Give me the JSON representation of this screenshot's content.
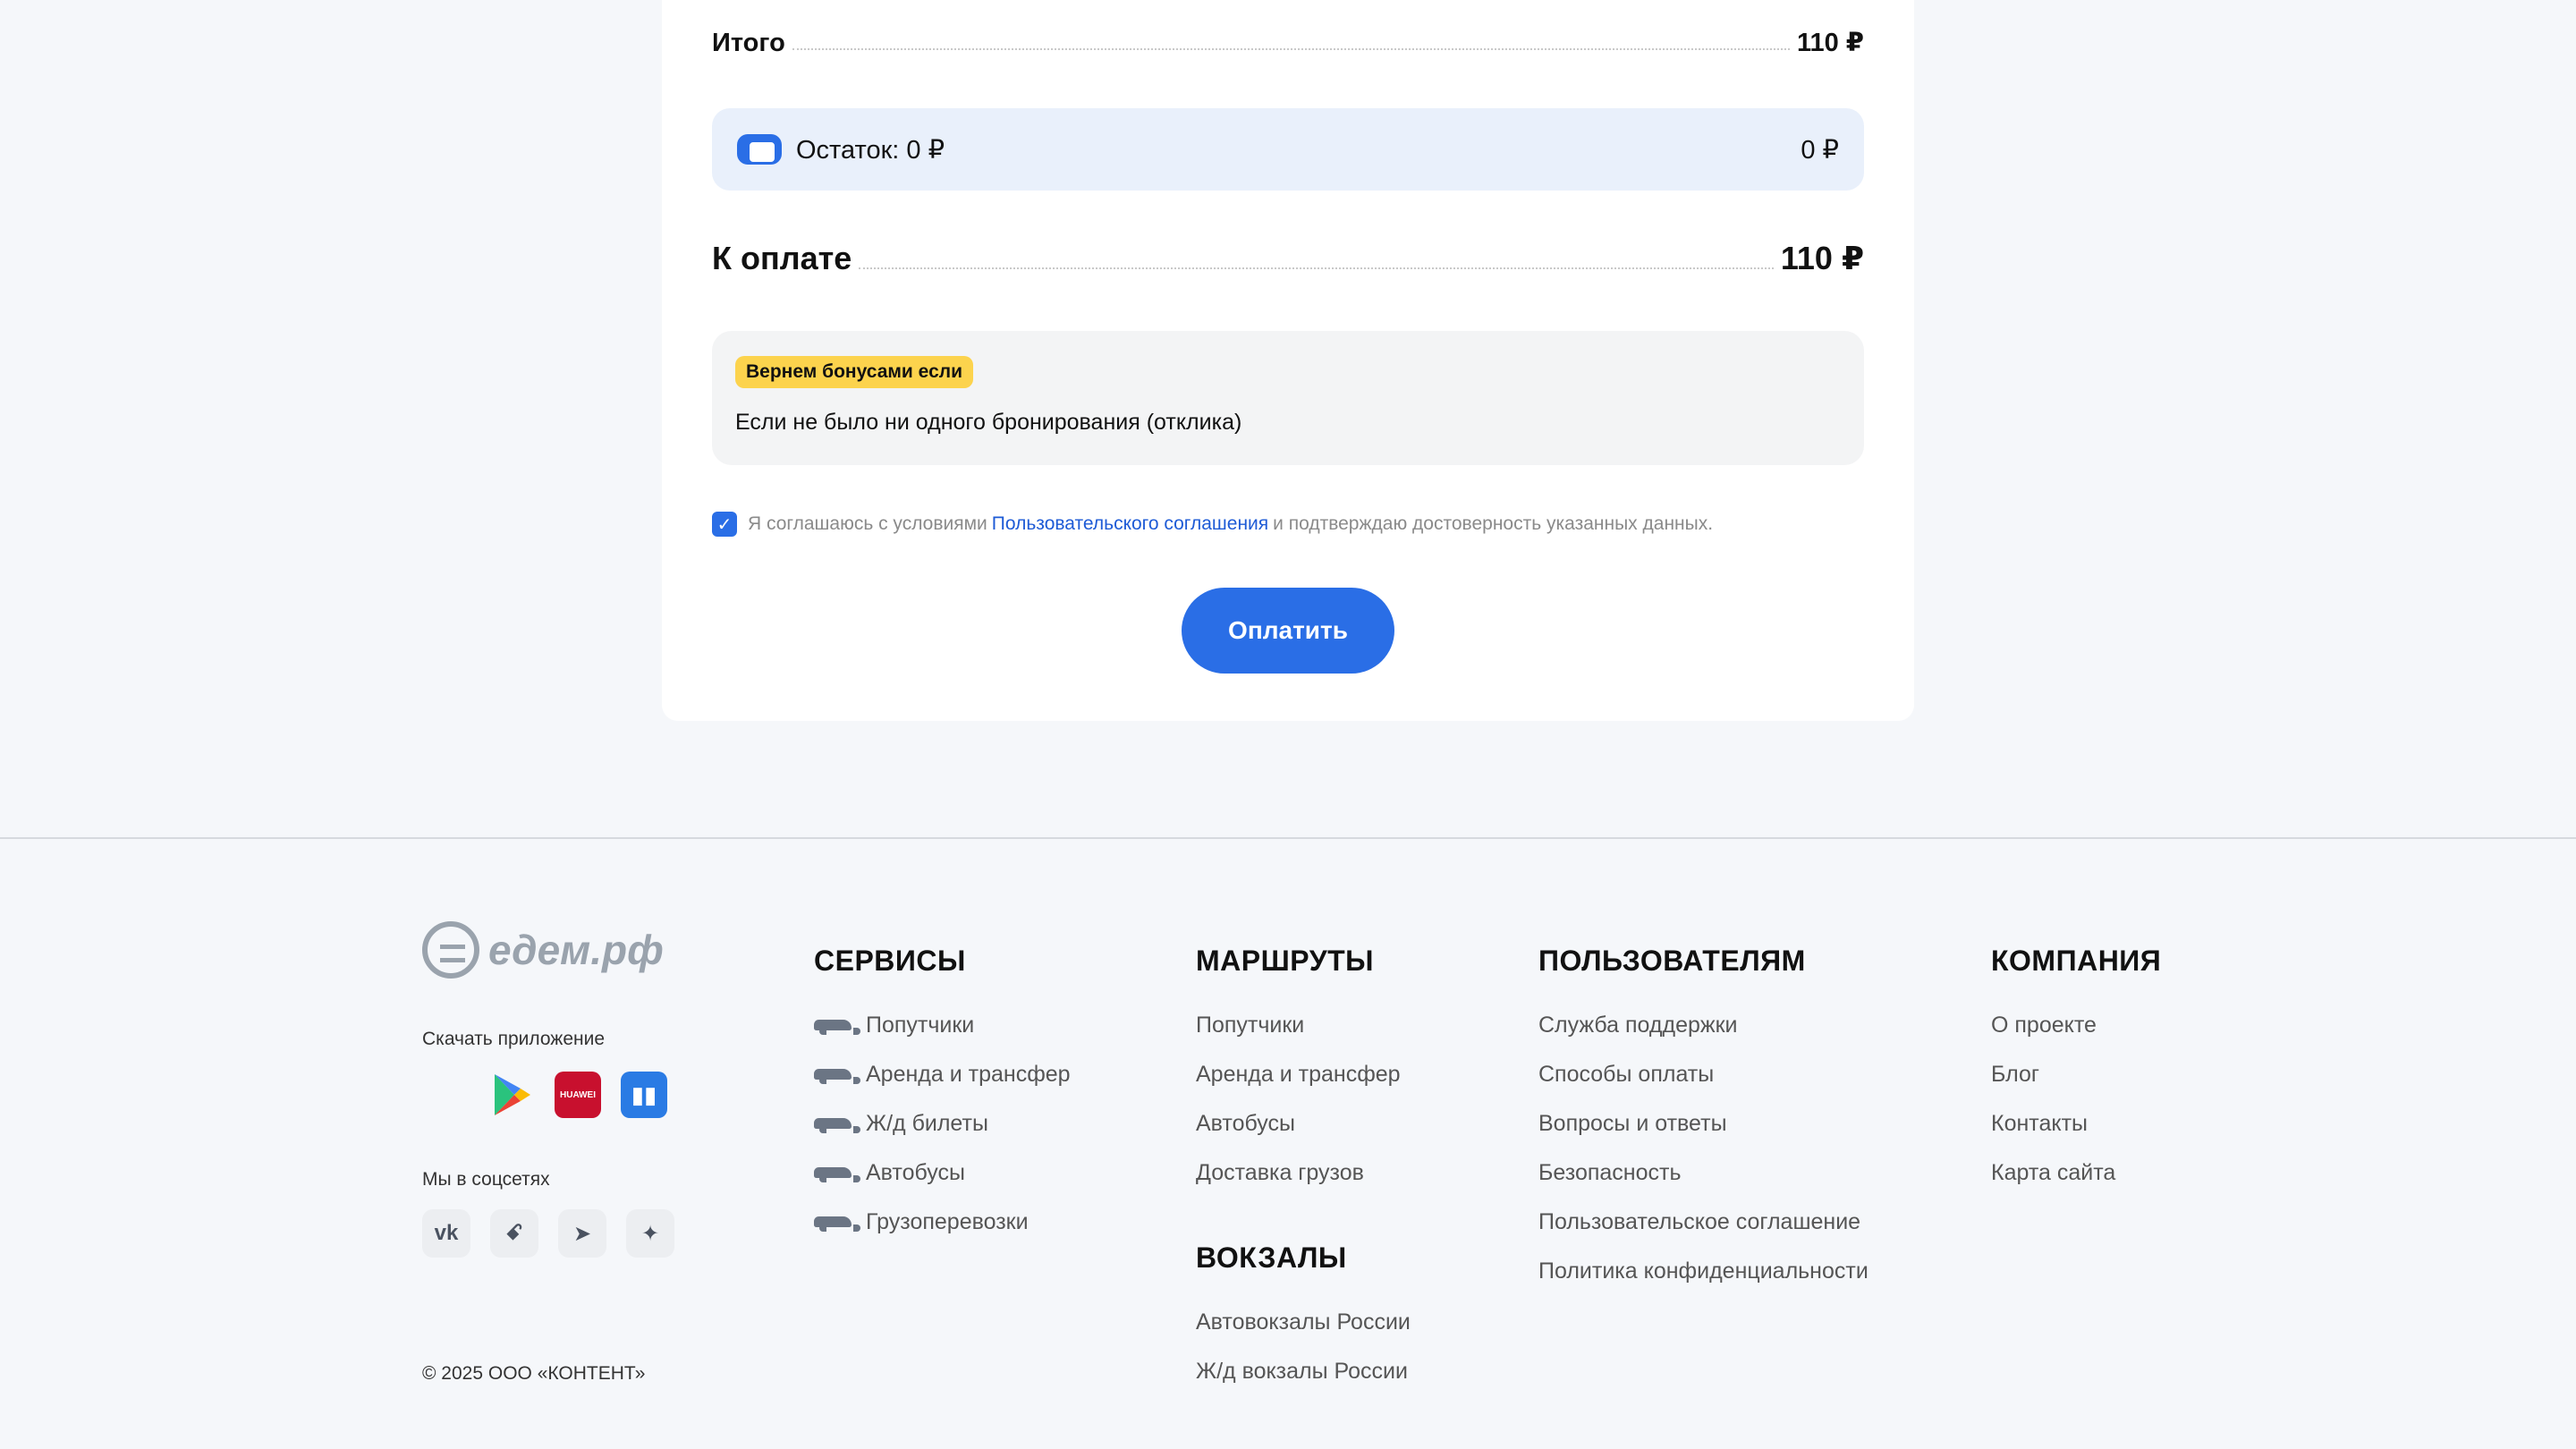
{
  "summary": {
    "total_label": "Итого",
    "total_value": "110 ₽",
    "balance_label": "Остаток: 0 ₽",
    "balance_value": "0 ₽",
    "pay_label": "К оплате",
    "pay_value": "110 ₽"
  },
  "bonus": {
    "badge": "Вернем бонусами если",
    "text": "Если не было ни одного бронирования (отклика)"
  },
  "agreement": {
    "checked": true,
    "text_before": "Я соглашаюсь с условиями",
    "link": "Пользовательского соглашения",
    "text_after": "и подтверждаю достоверность указанных данных."
  },
  "pay_button": "Оплатить",
  "footer": {
    "logo_text": "едем.рф",
    "download_title": "Скачать приложение",
    "apps": [
      {
        "name": "apple-app-store-icon"
      },
      {
        "name": "google-play-icon"
      },
      {
        "name": "huawei-appgallery-icon",
        "label": "HUAWEI"
      },
      {
        "name": "rustore-icon"
      }
    ],
    "social_title": "Мы в соцсетях",
    "socials": [
      {
        "name": "vk-icon",
        "glyph": "vk"
      },
      {
        "name": "odnoklassniki-icon",
        "glyph": "ꗃ"
      },
      {
        "name": "telegram-icon",
        "glyph": "➤"
      },
      {
        "name": "dzen-icon",
        "glyph": "✦"
      }
    ],
    "copyright": "© 2025 ООО «КОНТЕНТ»",
    "columns": {
      "services": {
        "title": "СЕРВИСЫ",
        "items": [
          "Попутчики",
          "Аренда и трансфер",
          "Ж/д билеты",
          "Автобусы",
          "Грузоперевозки"
        ]
      },
      "routes": {
        "title": "МАРШРУТЫ",
        "items": [
          "Попутчики",
          "Аренда и трансфер",
          "Автобусы",
          "Доставка грузов"
        ]
      },
      "stations": {
        "title": "ВОКЗАЛЫ",
        "items": [
          "Автовокзалы России",
          "Ж/д вокзалы России"
        ]
      },
      "users": {
        "title": "ПОЛЬЗОВАТЕЛЯМ",
        "items": [
          "Служба поддержки",
          "Способы оплаты",
          "Вопросы и ответы",
          "Безопасность",
          "Пользовательское соглашение",
          "Политика конфиденциальности"
        ]
      },
      "company": {
        "title": "КОМПАНИЯ",
        "items": [
          "О проекте",
          "Блог",
          "Контакты",
          "Карта сайта"
        ]
      }
    }
  },
  "colors": {
    "accent": "#2a6ee6",
    "badge": "#fcd34d",
    "balance_bg": "#e9f0fb",
    "page_bg": "#f5f7fa"
  }
}
